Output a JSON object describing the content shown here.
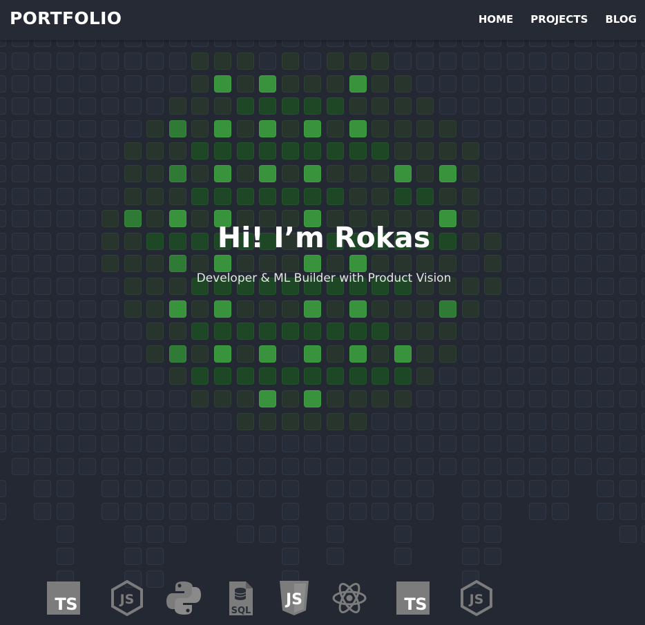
{
  "header": {
    "brand": "PORTFOLIO",
    "nav": [
      {
        "label": "HOME"
      },
      {
        "label": "PROJECTS"
      },
      {
        "label": "BLOG"
      }
    ]
  },
  "hero": {
    "title": "Hi! I’m Rokas",
    "subtitle": "Developer & ML Builder with Product Vision"
  },
  "tech_icons": [
    {
      "icon": "typescript-icon",
      "label": "TS"
    },
    {
      "icon": "nodejs-icon",
      "label": "JS"
    },
    {
      "icon": "python-icon",
      "label": ""
    },
    {
      "icon": "sql-icon",
      "label": "SQL"
    },
    {
      "icon": "javascript-icon",
      "label": "JS"
    },
    {
      "icon": "react-icon",
      "label": ""
    },
    {
      "icon": "typescript-icon",
      "label": "TS"
    },
    {
      "icon": "nodejs-icon",
      "label": "JS"
    }
  ],
  "colors": {
    "background": "#232832",
    "cell": "#272d38",
    "accent_green": "#38933c",
    "icon_gray": "#7c7c7c"
  }
}
